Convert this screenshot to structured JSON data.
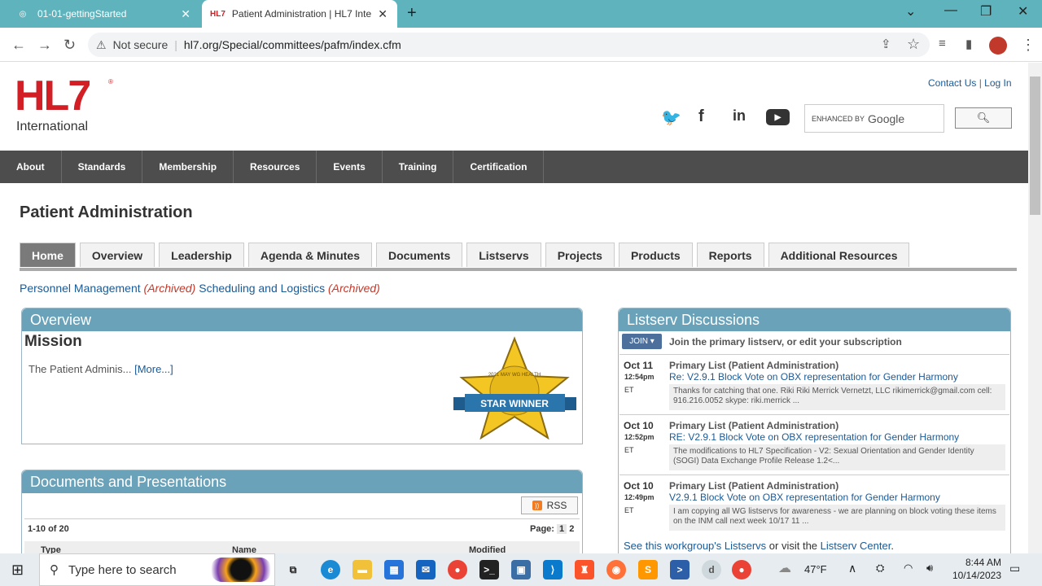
{
  "browser": {
    "tabs": [
      {
        "title": "01-01-gettingStarted"
      },
      {
        "title": "Patient Administration | HL7 Inte",
        "favicon": "HL7"
      }
    ],
    "not_secure": "Not secure",
    "url": "hl7.org/Special/committees/pafm/index.cfm"
  },
  "site": {
    "logo": "HL7",
    "logo_sub": "International",
    "contact": "Contact Us",
    "login": "Log In",
    "search_enhanced": "ENHANCED BY",
    "search_google": "Google",
    "nav": [
      "About",
      "Standards",
      "Membership",
      "Resources",
      "Events",
      "Training",
      "Certification"
    ]
  },
  "page": {
    "title": "Patient Administration",
    "tabs": [
      "Home",
      "Overview",
      "Leadership",
      "Agenda & Minutes",
      "Documents",
      "Listservs",
      "Projects",
      "Products",
      "Reports",
      "Additional Resources"
    ],
    "archived1": "Personnel Management",
    "archived2": "Scheduling and Logistics",
    "archived_tag": "(Archived)",
    "overview_title": "Overview",
    "mission_title": "Mission",
    "mission_text": "The Patient Adminis...",
    "more": "[More...]",
    "star_text": "STAR WINNER",
    "star_arc": "2021 MAY WG HEALTH",
    "docs_title": "Documents and Presentations",
    "rss": "RSS",
    "count": "1-10 of 20",
    "page_label": "Page:",
    "pages": [
      "1",
      "2"
    ],
    "columns": [
      "Type",
      "Name",
      "Modified"
    ],
    "listserv_title": "Listserv Discussions",
    "join": "JOIN",
    "join_text": "Join the primary listserv, or edit your subscription",
    "posts": [
      {
        "date": "Oct 11",
        "time": "12:54pm",
        "tz": "ET",
        "list": "Primary List (Patient Administration)",
        "subject": "Re: V2.9.1 Block Vote on OBX representation for Gender Harmony",
        "body": "Thanks for catching that one. Riki Riki Merrick Vernetzt, LLC rikimerrick@gmail.com cell: 916.216.0052 skype: riki.merrick ..."
      },
      {
        "date": "Oct 10",
        "time": "12:52pm",
        "tz": "ET",
        "list": "Primary List (Patient Administration)",
        "subject": "RE: V2.9.1 Block Vote on OBX representation for Gender Harmony",
        "body": "The modifications to HL7 Specification - V2: Sexual Orientation and Gender Identity (SOGI) Data Exchange Profile Release 1.2<..."
      },
      {
        "date": "Oct 10",
        "time": "12:49pm",
        "tz": "ET",
        "list": "Primary List (Patient Administration)",
        "subject": "V2.9.1 Block Vote on OBX representation for Gender Harmony",
        "body": "I am copying all WG listservs for awareness - we are planning on block voting these items on the INM call next week 10/17 11 ..."
      }
    ],
    "see_pre": "See this workgroup's ",
    "see_link1": "Listservs",
    "see_mid": " or visit the ",
    "see_link2": "Listserv Center",
    "see_end": "."
  },
  "taskbar": {
    "search_placeholder": "Type here to search",
    "weather": "47°F",
    "time": "8:44 AM",
    "date": "10/14/2023"
  }
}
